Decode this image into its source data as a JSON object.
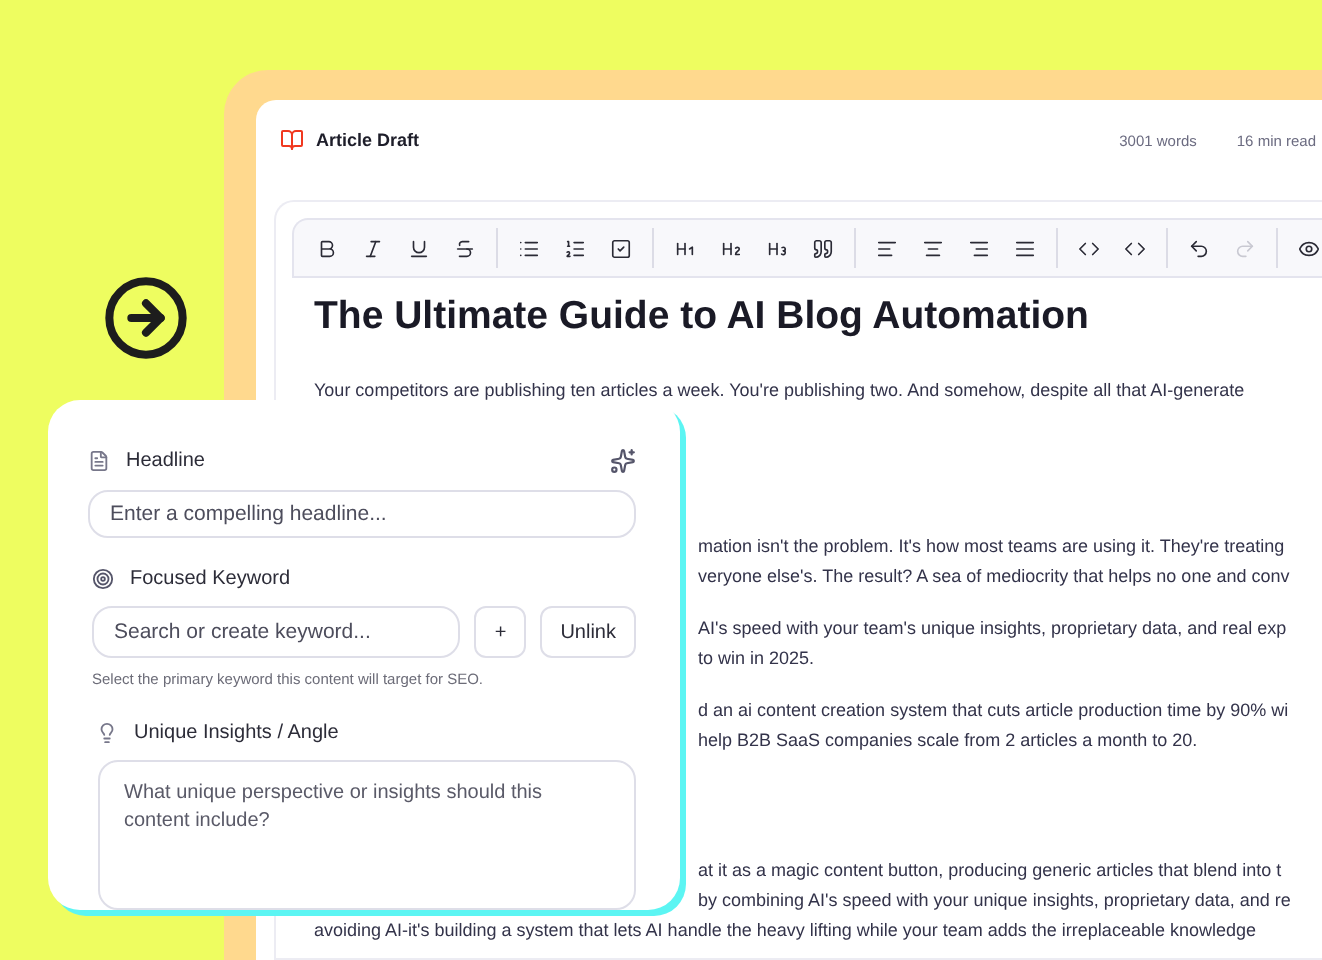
{
  "document": {
    "title": "Article Draft",
    "word_count": "3001 words",
    "read_time": "16 min read"
  },
  "toolbar": [
    [
      {
        "kind": "bold",
        "disabled": false
      },
      {
        "kind": "italic",
        "disabled": false
      },
      {
        "kind": "underline",
        "disabled": false
      },
      {
        "kind": "strike",
        "disabled": false
      }
    ],
    [
      {
        "kind": "bullets",
        "disabled": false
      },
      {
        "kind": "numbers",
        "disabled": false
      },
      {
        "kind": "task",
        "disabled": false
      }
    ],
    [
      {
        "kind": "h1",
        "disabled": false
      },
      {
        "kind": "h2",
        "disabled": false
      },
      {
        "kind": "h3",
        "disabled": false
      },
      {
        "kind": "quote",
        "disabled": false
      }
    ],
    [
      {
        "kind": "left",
        "disabled": false
      },
      {
        "kind": "center",
        "disabled": false
      },
      {
        "kind": "right",
        "disabled": false
      },
      {
        "kind": "justify",
        "disabled": false
      }
    ],
    [
      {
        "kind": "code",
        "disabled": false
      },
      {
        "kind": "code",
        "disabled": false
      }
    ],
    [
      {
        "kind": "undo",
        "disabled": false
      },
      {
        "kind": "redo",
        "disabled": true
      }
    ],
    [
      {
        "kind": "preview",
        "disabled": false
      }
    ]
  ],
  "article": {
    "heading": "The Ultimate Guide to AI Blog Automation",
    "lines": [
      {
        "kind": "full",
        "text": "Your competitors are publishing ten articles a week. You're publishing two. And somehow, despite all that AI-generate"
      },
      {
        "kind": "section",
        "text": "mation isn't the problem. It's how most teams are using it. They're treating"
      },
      {
        "kind": "clipped",
        "text": "veryone else's. The result? A sea of mediocrity that helps no one and conv"
      },
      {
        "kind": "paragraph",
        "text": "AI's speed with your team's unique insights, proprietary data, and real exp"
      },
      {
        "kind": "clipped",
        "text": "to win in 2025."
      },
      {
        "kind": "paragraph",
        "text": "d an ai content creation system that cuts article production time by 90% wi"
      },
      {
        "kind": "clipped",
        "text": "help B2B SaaS companies scale from 2 articles a month to 20."
      },
      {
        "kind": "subsection",
        "text": "at it as a magic content button, producing generic articles that blend into t"
      },
      {
        "kind": "clipped",
        "text": "by combining AI's speed with your unique insights, proprietary data, and re"
      },
      {
        "kind": "full",
        "text": "avoiding AI-it's building a system that lets AI handle the heavy lifting while your team adds the irreplaceable knowledge"
      }
    ]
  },
  "form": {
    "headline": {
      "label": "Headline",
      "placeholder": "Enter a compelling headline..."
    },
    "keyword": {
      "label": "Focused Keyword",
      "placeholder": "Search or create keyword...",
      "add": "+",
      "unlink": "Unlink",
      "hint": "Select the primary keyword this content will target for SEO."
    },
    "insights": {
      "label": "Unique Insights / Angle",
      "placeholder": "What unique perspective or insights should this content include?"
    }
  }
}
